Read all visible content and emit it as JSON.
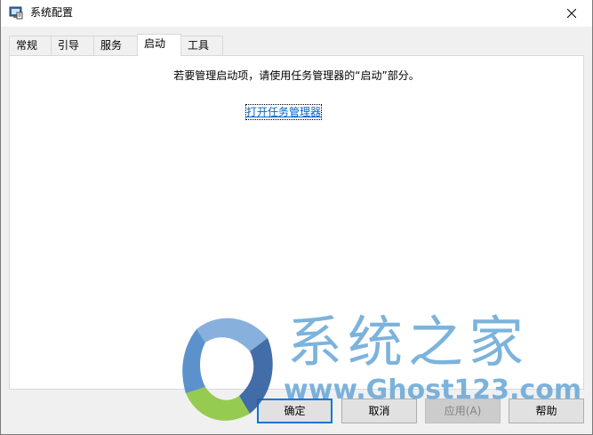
{
  "window": {
    "title": "系统配置",
    "app_icon": "msconfig-icon",
    "close_icon": "close-icon"
  },
  "tabs": [
    {
      "label": "常规",
      "active": false
    },
    {
      "label": "引导",
      "active": false
    },
    {
      "label": "服务",
      "active": false
    },
    {
      "label": "启动",
      "active": true
    },
    {
      "label": "工具",
      "active": false
    }
  ],
  "startup_tab": {
    "message": "若要管理启动项，请使用任务管理器的“启动”部分。",
    "link": "打开任务管理器"
  },
  "buttons": {
    "ok": "确定",
    "cancel": "取消",
    "apply": "应用(A)",
    "help": "帮助"
  },
  "watermark": {
    "name": "系统之家",
    "url": "www.Ghost123.com"
  },
  "colors": {
    "link": "#0066cc",
    "default_button_border": "#0078d7",
    "watermark": "#6aa9d8"
  }
}
